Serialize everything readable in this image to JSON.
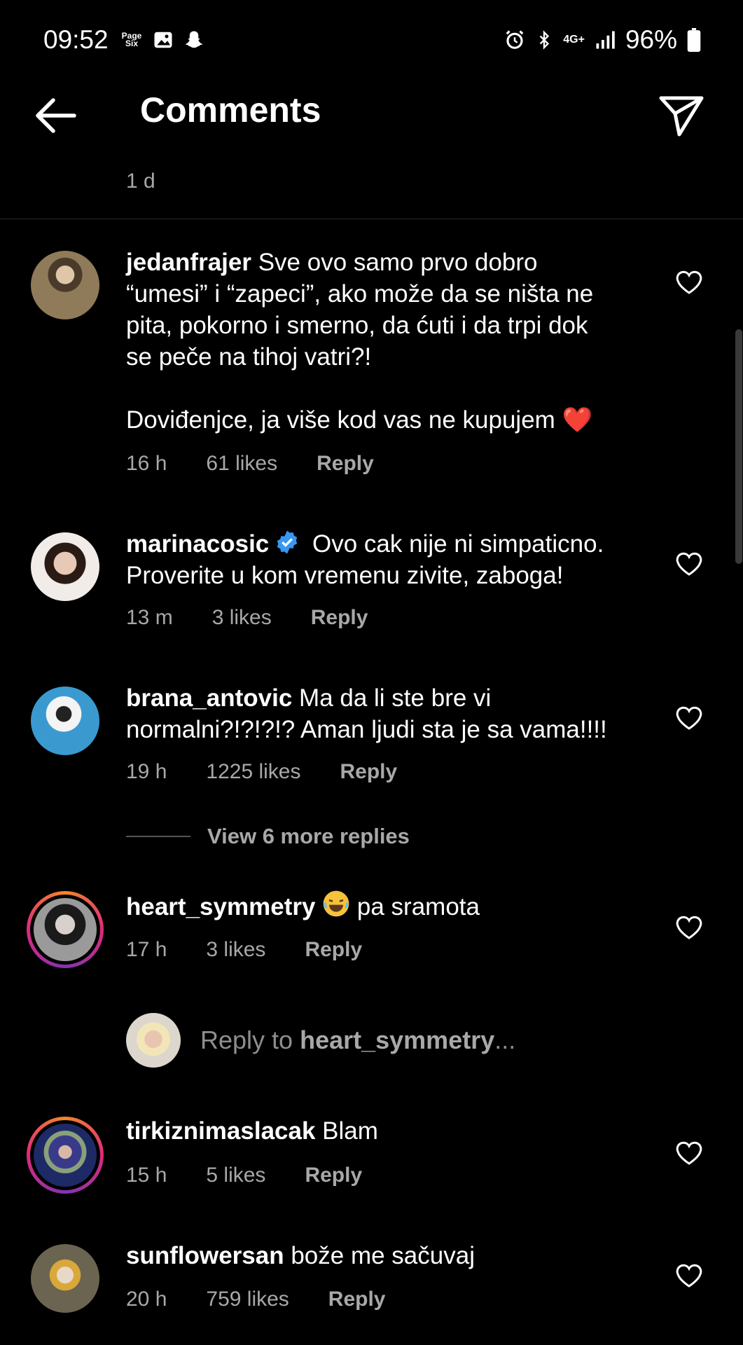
{
  "status_bar": {
    "time": "09:52",
    "notif_icons": [
      "page-six-icon",
      "gallery-icon",
      "snapchat-icon"
    ],
    "pagesix_line1": "Page",
    "pagesix_line2": "Six",
    "network": "4G+",
    "battery": "96%"
  },
  "header": {
    "title": "Comments"
  },
  "post_age": "1 d",
  "comments": [
    {
      "username": "jedanfrajer",
      "text_lines": [
        " Sve ovo samo prvo dobro",
        "“umesi” i “zapeci”, ako može da se ništa ne",
        "pita, pokorno i smerno, da ćuti i da trpi dok",
        "se peče na tihoj vatri?!",
        "",
        "Doviđenjce, ja više kod vas ne kupujem ❤️"
      ],
      "time": "16 h",
      "likes": "61 likes",
      "reply": "Reply",
      "avatar_color": "#7a6a55"
    },
    {
      "username": "marinacosic",
      "text_lines": [
        " Ovo cak nije ni simpaticno.",
        "Proverite u kom vremenu zivite, zaboga!"
      ],
      "time": "13 m",
      "likes": "3 likes",
      "reply": "Reply",
      "avatar_color": "#d9cfc8"
    },
    {
      "username": "brana_antovic",
      "text_lines": [
        " Ma da li ste bre vi",
        "normalni?!?!?!? Aman ljudi sta je sa vama!!!!"
      ],
      "time": "19 h",
      "likes": "1225 likes",
      "reply": "Reply",
      "avatar_color": "#3a9ad0"
    },
    {
      "username": "heart_symmetry",
      "text_lines": [
        " pa sramota"
      ],
      "time": "17 h",
      "likes": "3 likes",
      "reply": "Reply",
      "avatar_color": "#c8c8c8"
    },
    {
      "username": "tirkiznimaslacak",
      "text_lines": [
        " Blam"
      ],
      "time": "15 h",
      "likes": "5 likes",
      "reply": "Reply",
      "avatar_color": "#2a3d7a"
    },
    {
      "username": "sunflowersan",
      "text_lines": [
        " bože me sačuvaj"
      ],
      "time": "20 h",
      "likes": "759 likes",
      "reply": "Reply",
      "avatar_color": "#8a8470"
    }
  ],
  "view_more": "View 6 more replies",
  "reply_to": {
    "prefix": "Reply to ",
    "username": "heart_symmetry",
    "suffix": "..."
  },
  "colors": {
    "background": "#000000",
    "secondary_text": "#a8a8a8",
    "verified": "#3897f0"
  }
}
